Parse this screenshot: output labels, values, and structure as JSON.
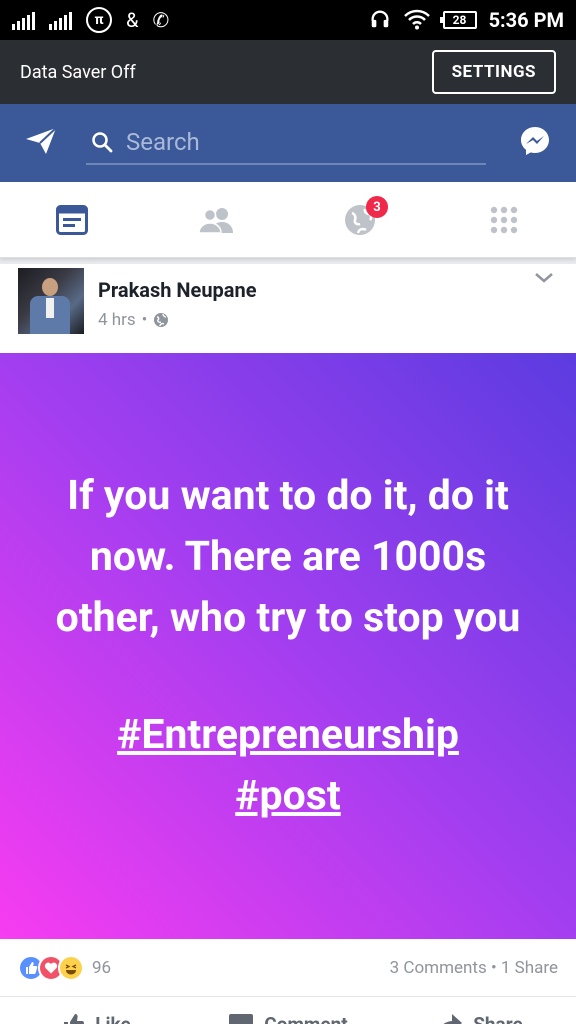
{
  "status_bar": {
    "time": "5:36 PM",
    "battery": "28",
    "icons": [
      "signal-icon",
      "signal-icon",
      "pi-icon",
      "app-icon",
      "phone-wifi-icon",
      "headset-icon",
      "wifi-icon",
      "battery-icon"
    ]
  },
  "data_saver": {
    "text": "Data Saver Off",
    "button": "SETTINGS"
  },
  "header": {
    "search_placeholder": "Search"
  },
  "tabs": {
    "notifications_badge": "3"
  },
  "post": {
    "author": "Prakash Neupane",
    "time": "4 hrs",
    "dot": "•",
    "text": "If you want to do it, do it now. There are 1000s other, who try to stop you",
    "hashtag1": "#Entrepreneurship",
    "hashtag2": "#post",
    "gradient_colors": [
      "#f83cf1",
      "#a33ef0",
      "#5b3ce0"
    ],
    "reaction_count": "96",
    "comments_shares": "3 Comments • 1 Share"
  },
  "actions": {
    "like": "Like",
    "comment": "Comment",
    "share": "Share"
  },
  "colors": {
    "fb_blue": "#3b5998",
    "saver_bg": "#2b2f33",
    "badge": "#f02849"
  }
}
